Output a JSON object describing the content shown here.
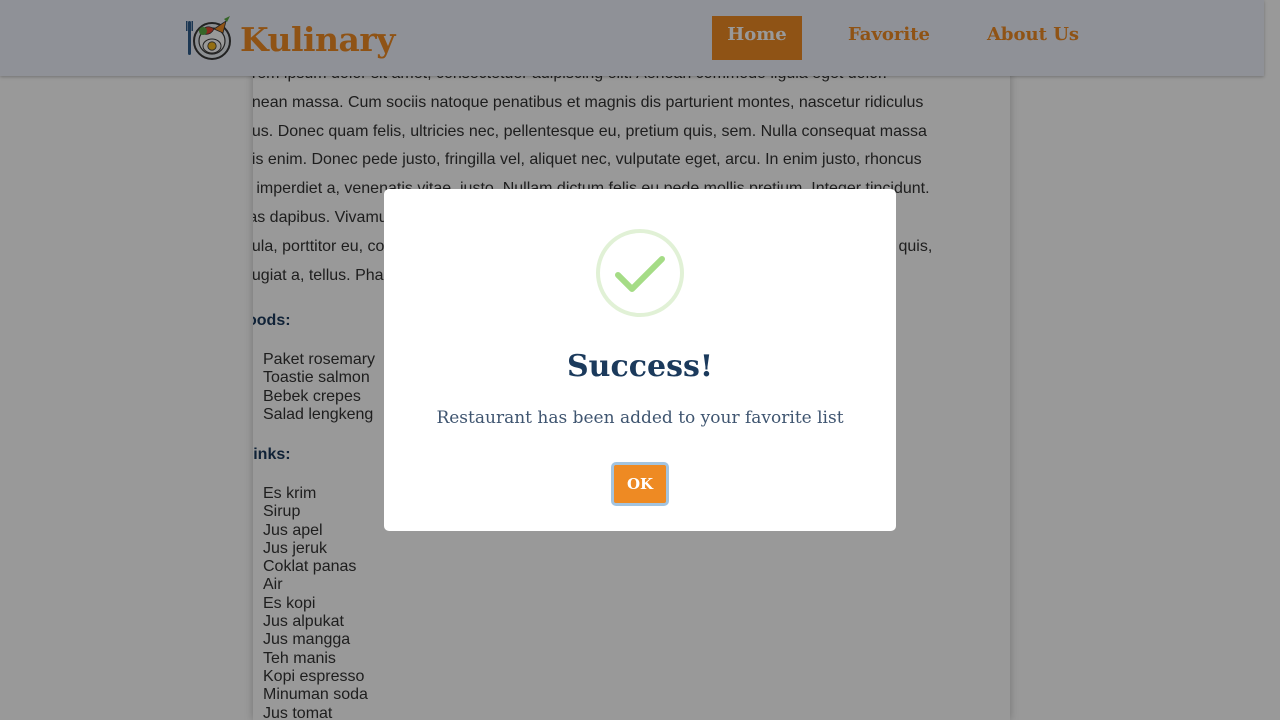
{
  "header": {
    "brand": "Kulinary",
    "logo_icon": "food-plate-logo-icon",
    "nav": [
      {
        "label": "Home",
        "active": true
      },
      {
        "label": "Favorite",
        "active": false
      },
      {
        "label": "About Us",
        "active": false
      }
    ]
  },
  "detail": {
    "description_lines": [
      "orem ipsum dolor sit amet, consectetuer adipiscing elit. Aenean commodo ligula eget dolor.",
      "enean massa. Cum sociis natoque penatibus et magnis dis parturient montes, nascetur ridiculus",
      "nus. Donec quam felis, ultricies nec, pellentesque eu, pretium quis, sem. Nulla consequat massa",
      "uis enim. Donec pede justo, fringilla vel, aliquet nec, vulputate eget, arcu. In enim justo, rhoncus",
      "t, imperdiet a, venenatis vitae, justo. Nullam dictum felis eu pede mollis pretium. Integer tincidunt.",
      "ras dapibus. Vivamus elementum semper nisi. Aenean vulputate eleifend tellus. Aenean leo",
      "gula, porttitor eu, consequat vitae, eleifend ac, enim. Aliquam lorem ante, dapibus in, viverra quis,",
      "eugiat a, tellus. Phasellus viverra nulla ut metus varius laoreet."
    ],
    "foods_heading": "oods:",
    "foods": [
      "Paket rosemary",
      "Toastie salmon",
      "Bebek crepes",
      "Salad lengkeng"
    ],
    "drinks_heading": "rinks:",
    "drinks": [
      "Es krim",
      "Sirup",
      "Jus apel",
      "Jus jeruk",
      "Coklat panas",
      "Air",
      "Es kopi",
      "Jus alpukat",
      "Jus mangga",
      "Teh manis",
      "Kopi espresso",
      "Minuman soda",
      "Jus tomat"
    ]
  },
  "modal": {
    "icon": "success-check-icon",
    "title": "Success!",
    "message": "Restaurant has been added to your favorite list",
    "ok_label": "OK"
  },
  "colors": {
    "accent": "#ee8a23",
    "header_bg": "#eef2fc",
    "heading": "#1b3a5c",
    "success": "#a5dc86"
  }
}
